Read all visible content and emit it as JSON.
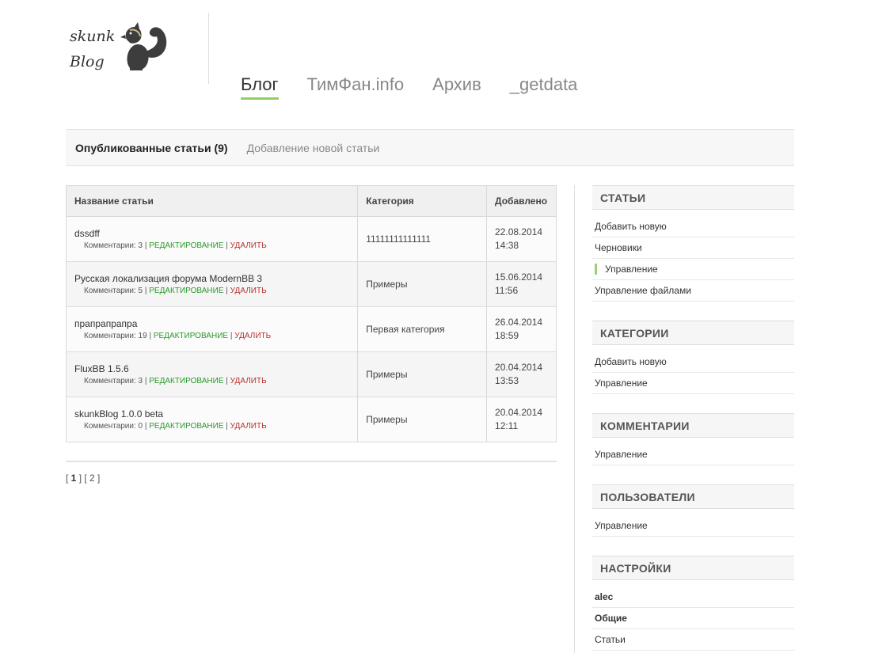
{
  "header": {
    "logo_line1": "skunk",
    "logo_line2": "Blog",
    "nav": [
      {
        "label": "Блог",
        "active": true
      },
      {
        "label": "ТимФан.info"
      },
      {
        "label": "Архив"
      },
      {
        "label": "_getdata"
      }
    ]
  },
  "subtabs": {
    "published": "Опубликованные статьи (9)",
    "add_new": "Добавление новой статьи"
  },
  "table": {
    "headers": [
      "Название статьи",
      "Категория",
      "Добавлено"
    ],
    "comments_label": "Комментарии:",
    "edit_label": "РЕДАКТИРОВАНИЕ",
    "delete_label": "УДАЛИТЬ",
    "rows": [
      {
        "title": "dssdff",
        "comments": "3",
        "category": "11111111111111",
        "date": "22.08.2014",
        "time": "14:38"
      },
      {
        "title": "Русская локализация форума ModernBB 3",
        "comments": "5",
        "category": "Примеры",
        "date": "15.06.2014",
        "time": "11:56"
      },
      {
        "title": "прапрапрапра",
        "comments": "19",
        "category": "Первая категория",
        "date": "26.04.2014",
        "time": "18:59"
      },
      {
        "title": "FluxBB 1.5.6",
        "comments": "3",
        "category": "Примеры",
        "date": "20.04.2014",
        "time": "13:53"
      },
      {
        "title": "skunkBlog 1.0.0 beta",
        "comments": "0",
        "category": "Примеры",
        "date": "20.04.2014",
        "time": "12:11"
      }
    ]
  },
  "pager": {
    "current": "1",
    "other": "2"
  },
  "sidebar": {
    "articles": {
      "title": "СТАТЬИ",
      "items": [
        "Добавить новую",
        "Черновики",
        "Управление",
        "Управление файлами"
      ]
    },
    "categories": {
      "title": "КАТЕГОРИИ",
      "items": [
        "Добавить новую",
        "Управление"
      ]
    },
    "comments": {
      "title": "КОММЕНТАРИИ",
      "items": [
        "Управление"
      ]
    },
    "users": {
      "title": "ПОЛЬЗОВАТЕЛИ",
      "items": [
        "Управление"
      ]
    },
    "settings": {
      "title": "НАСТРОЙКИ",
      "items": [
        "alec",
        "Общие",
        "Статьи"
      ]
    }
  },
  "colors": {
    "accent_green": "#8fd15e",
    "edit_link": "#2a9a2a",
    "delete_link": "#b83232"
  }
}
